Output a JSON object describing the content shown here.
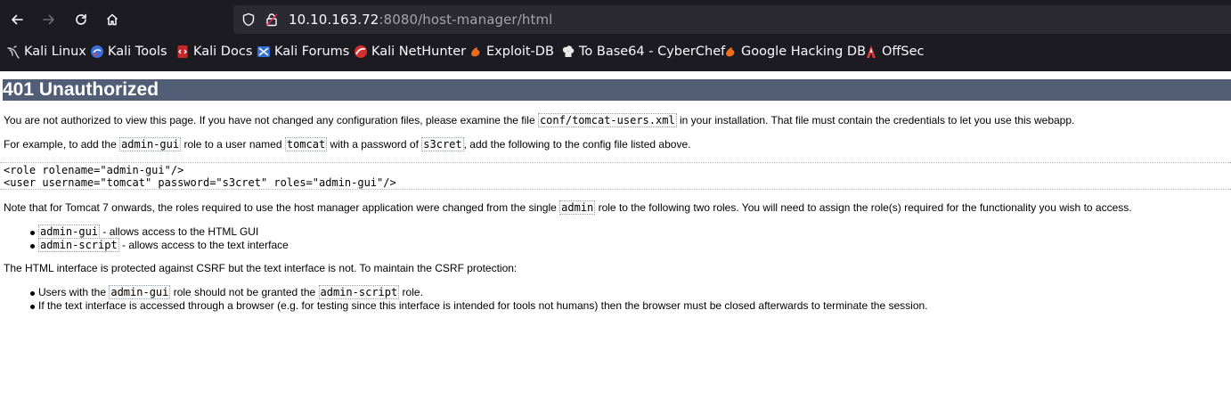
{
  "browser": {
    "url_host": "10.10.163.72",
    "url_rest": ":8080/host-manager/html",
    "bookmarks": [
      {
        "label": "Kali Linux",
        "icon": "kali-dragon-icon"
      },
      {
        "label": "Kali Tools",
        "icon": "kali-tools-icon"
      },
      {
        "label": "Kali Docs",
        "icon": "kali-docs-icon"
      },
      {
        "label": "Kali Forums",
        "icon": "kali-forums-icon"
      },
      {
        "label": "Kali NetHunter",
        "icon": "kali-nethunter-icon"
      },
      {
        "label": "Exploit-DB",
        "icon": "exploit-db-icon"
      },
      {
        "label": "To Base64 - CyberChef",
        "icon": "cyberchef-icon"
      },
      {
        "label": "Google Hacking DB",
        "icon": "ghdb-icon"
      },
      {
        "label": "OffSec",
        "icon": "offsec-icon"
      }
    ]
  },
  "page": {
    "title": "401 Unauthorized",
    "p1": {
      "before": "You are not authorized to view this page. If you have not changed any configuration files, please examine the file ",
      "code": "conf/tomcat-users.xml",
      "after": " in your installation. That file must contain the credentials to let you use this webapp."
    },
    "p2": {
      "t1": "For example, to add the ",
      "c1": "admin-gui",
      "t2": " role to a user named ",
      "c2": "tomcat",
      "t3": " with a password of ",
      "c3": "s3cret",
      "t4": ", add the following to the config file listed above."
    },
    "pre_line1": "<role rolename=\"admin-gui\"/>",
    "pre_line2": "<user username=\"tomcat\" password=\"s3cret\" roles=\"admin-gui\"/>",
    "p3": {
      "before": "Note that for Tomcat 7 onwards, the roles required to use the host manager application were changed from the single ",
      "code": "admin",
      "after": " role to the following two roles. You will need to assign the role(s) required for the functionality you wish to access."
    },
    "roles": [
      {
        "code": "admin-gui",
        "text": " - allows access to the HTML GUI"
      },
      {
        "code": "admin-script",
        "text": " - allows access to the text interface"
      }
    ],
    "p4": "The HTML interface is protected against CSRF but the text interface is not. To maintain the CSRF protection:",
    "csrf": {
      "item1": {
        "t1": "Users with the ",
        "c1": "admin-gui",
        "t2": " role should not be granted the ",
        "c2": "admin-script",
        "t3": " role."
      },
      "item2": "If the text interface is accessed through a browser (e.g. for testing since this interface is intended for tools not humans) then the browser must be closed afterwards to terminate the session."
    }
  },
  "colors": {
    "chrome_bg": "#1c1b22",
    "urlbar_bg": "#2b2a33",
    "title_bar": "#525d76"
  }
}
